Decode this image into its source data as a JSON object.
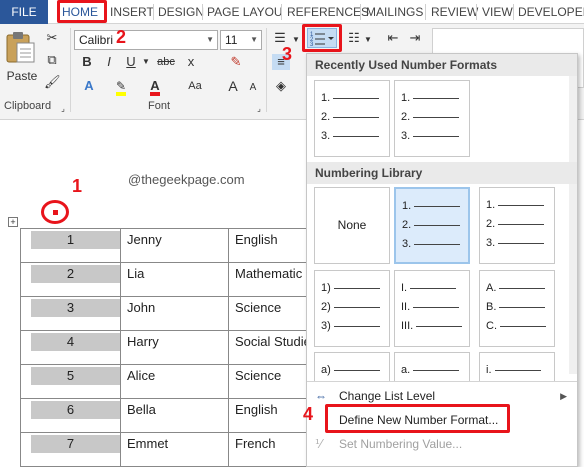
{
  "tabs": {
    "file": "FILE",
    "home": "HOME",
    "insert": "INSERT",
    "design": "DESIGN",
    "page_layout": "PAGE LAYOU",
    "references": "REFERENCES",
    "mailings": "MAILINGS",
    "review": "REVIEW",
    "view": "VIEW",
    "developer": "DEVELOPER"
  },
  "ribbon": {
    "paste_label": "Paste",
    "clipboard_label": "Clipboard",
    "font_label": "Font",
    "font_name": "Calibri",
    "font_size": "11",
    "bold": "B",
    "italic": "I",
    "underline": "U",
    "strike": "abc",
    "subscript": "x",
    "grow": "A",
    "shrink": "A",
    "case": "Aa",
    "color_a": "A",
    "font_a": "A"
  },
  "steps": {
    "s1": "1",
    "s2": "2",
    "s3": "3",
    "s4": "4"
  },
  "document": {
    "watermark": "@thegeekpage.com",
    "rows": [
      {
        "num": "1",
        "name": "Jenny",
        "subject": "English"
      },
      {
        "num": "2",
        "name": "Lia",
        "subject": "Mathematic"
      },
      {
        "num": "3",
        "name": "John",
        "subject": "Science"
      },
      {
        "num": "4",
        "name": "Harry",
        "subject": "Social Studie"
      },
      {
        "num": "5",
        "name": "Alice",
        "subject": "Science"
      },
      {
        "num": "6",
        "name": "Bella",
        "subject": "English"
      },
      {
        "num": "7",
        "name": "Emmet",
        "subject": "French"
      }
    ]
  },
  "dropdown": {
    "recent_title": "Recently Used Number Formats",
    "library_title": "Numbering Library",
    "none_label": "None",
    "recent": [
      [
        "1.",
        "2.",
        "3."
      ],
      [
        "1.",
        "2.",
        "3."
      ]
    ],
    "library": [
      [
        "1.",
        "2.",
        "3."
      ],
      [
        "1.",
        "2.",
        "3."
      ],
      [
        "1)",
        "2)",
        "3)"
      ],
      [
        "I.",
        "II.",
        "III."
      ],
      [
        "A.",
        "B.",
        "C."
      ],
      [
        "a)"
      ],
      [
        "a."
      ],
      [
        "i."
      ]
    ],
    "menu": {
      "change_level": "Change List Level",
      "define_new": "Define New Number Format...",
      "set_value": "Set Numbering Value..."
    }
  },
  "colors": {
    "accent": "#2b579a",
    "highlight": "#e8141b",
    "selected_tile": "#dcebfb"
  }
}
